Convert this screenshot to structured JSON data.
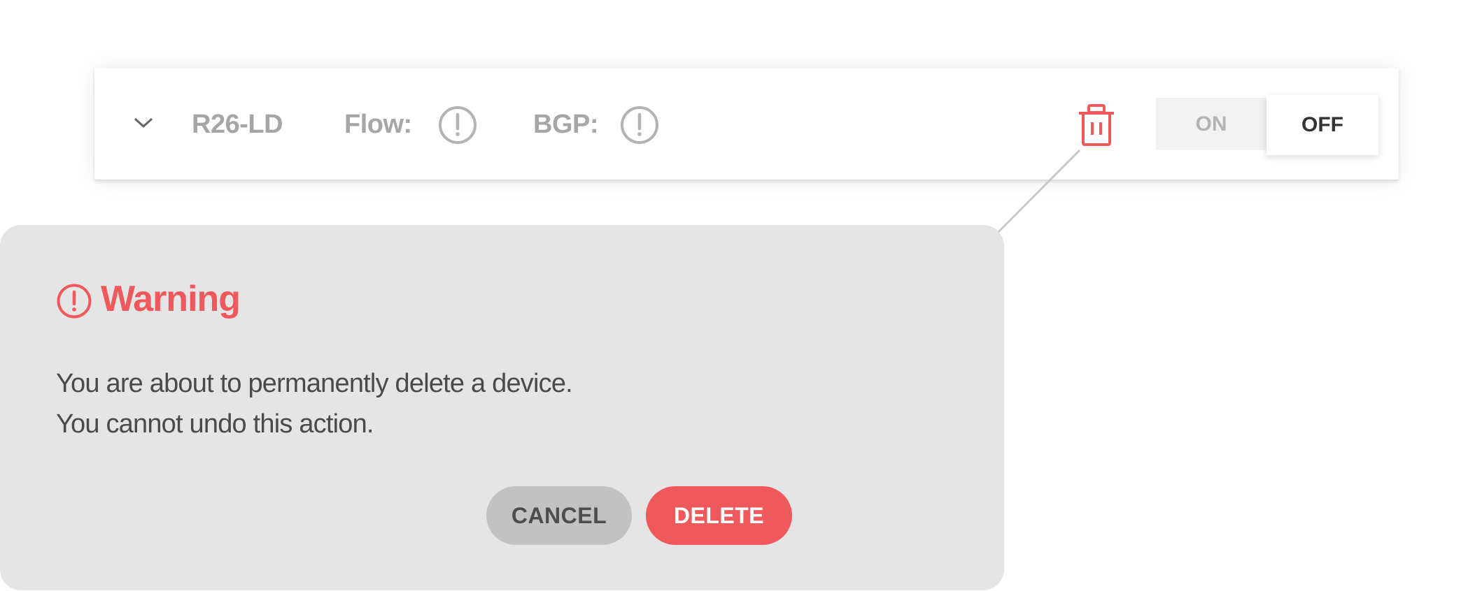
{
  "device_row": {
    "name": "R26-LD",
    "flow_label": "Flow:",
    "flow_status_icon": "alert-circle-icon",
    "bgp_label": "BGP:",
    "bgp_status_icon": "alert-circle-icon",
    "delete_icon": "trash-icon",
    "expand_icon": "chevron-down-icon",
    "toggle": {
      "on_label": "ON",
      "off_label": "OFF",
      "selected": "OFF"
    }
  },
  "popover": {
    "title": "Warning",
    "title_icon": "alert-circle-icon",
    "message_line1": "You are about to permanently delete a device.",
    "message_line2": "You cannot undo this action.",
    "cancel_label": "CANCEL",
    "delete_label": "DELETE"
  },
  "colors": {
    "danger": "#f0595c",
    "muted_text": "#a6a6a6",
    "popover_bg": "#e5e5e5",
    "cancel_bg": "#c2c2c2"
  }
}
